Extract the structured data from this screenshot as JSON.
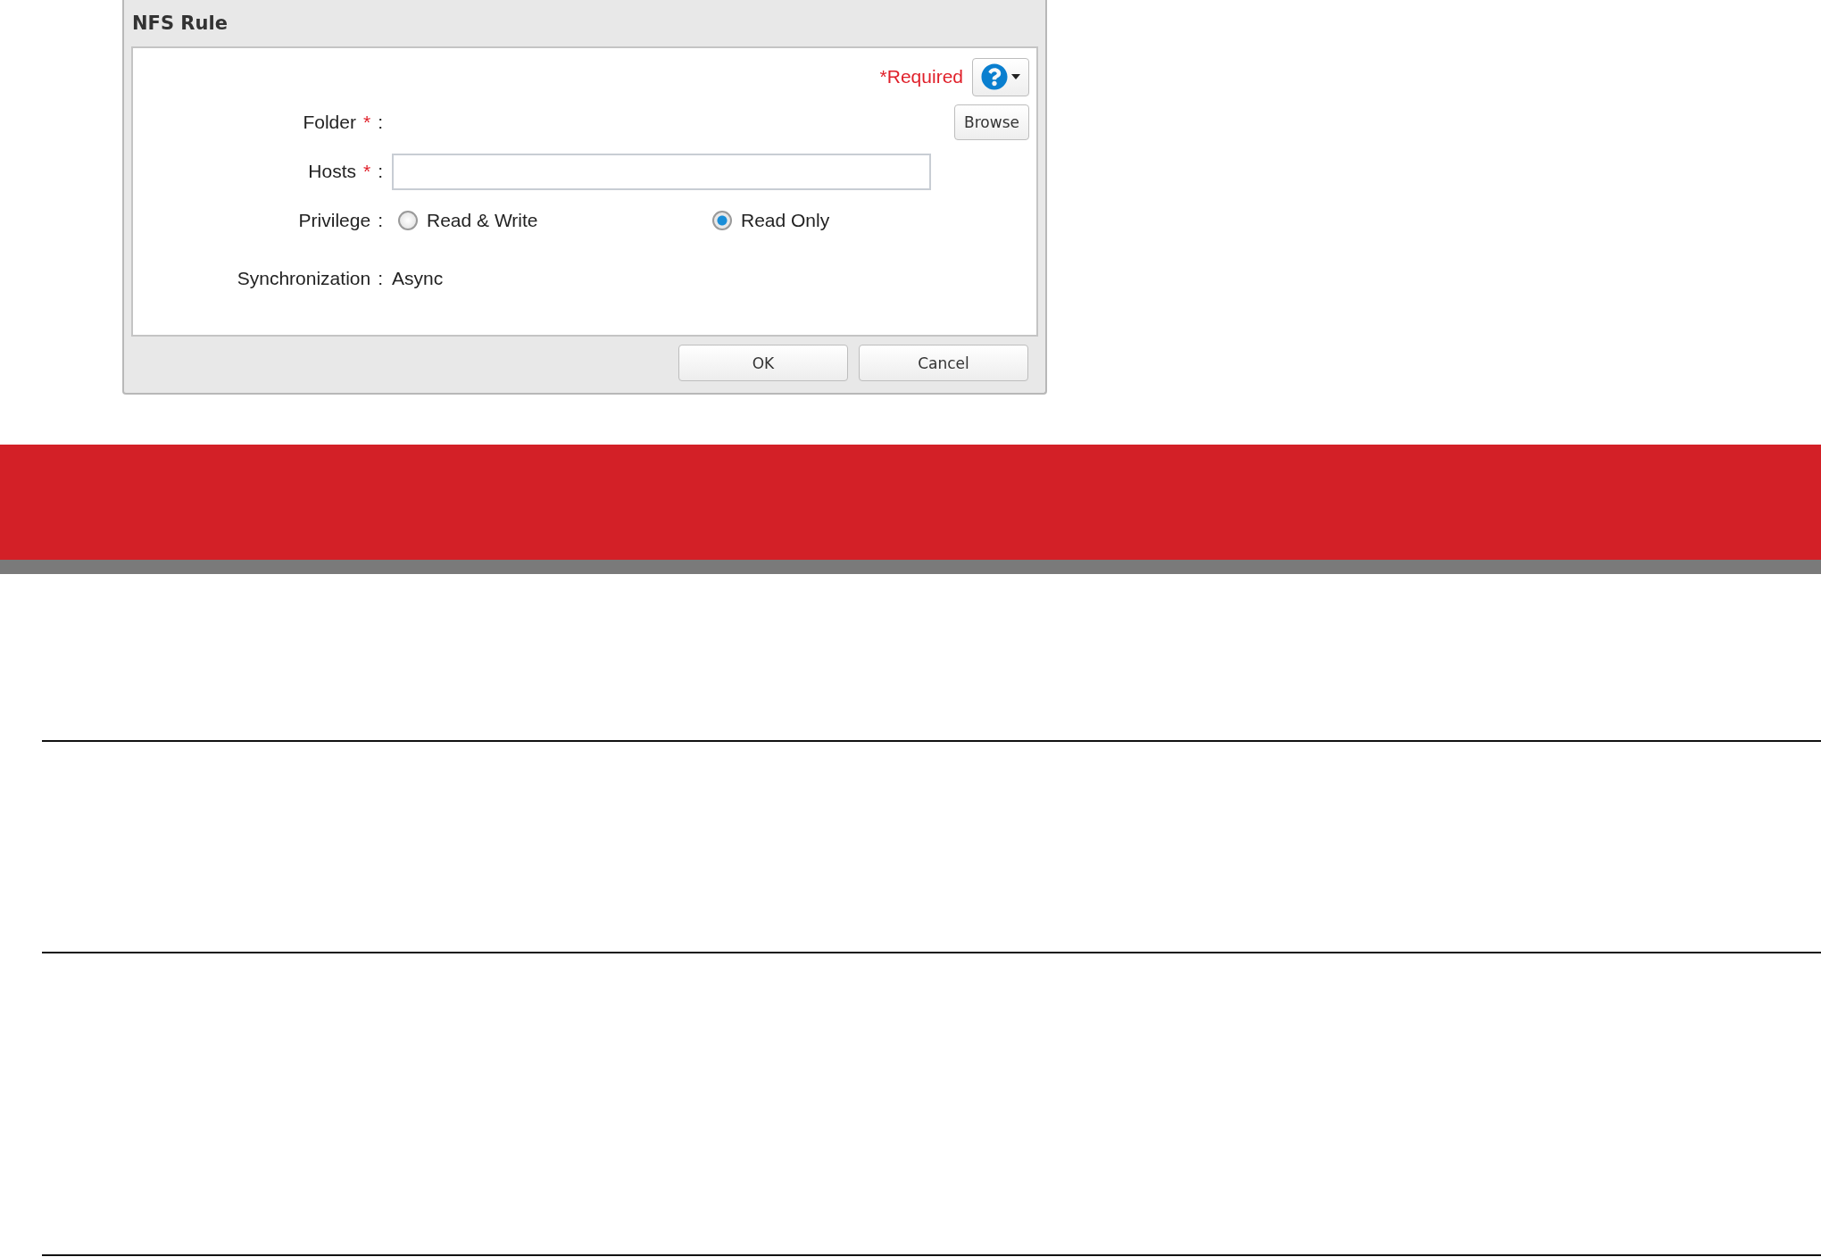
{
  "dialog": {
    "title": "NFS Rule",
    "required_note": "*Required",
    "fields": [
      {
        "kind": "browse",
        "label": "Folder",
        "required_mark": "*",
        "separator": ":",
        "button": "Browse"
      },
      {
        "kind": "text",
        "label": "Hosts",
        "required_mark": "*",
        "separator": ":"
      },
      {
        "kind": "radio",
        "label": "Privilege",
        "separator": ":",
        "options": [
          {
            "label": "Read & Write",
            "selected": false
          },
          {
            "label": "Read Only",
            "selected": true
          }
        ]
      },
      {
        "kind": "static",
        "label": "Synchronization",
        "separator": ":",
        "value": "Async"
      }
    ],
    "buttons": [
      "OK",
      "Cancel"
    ]
  }
}
